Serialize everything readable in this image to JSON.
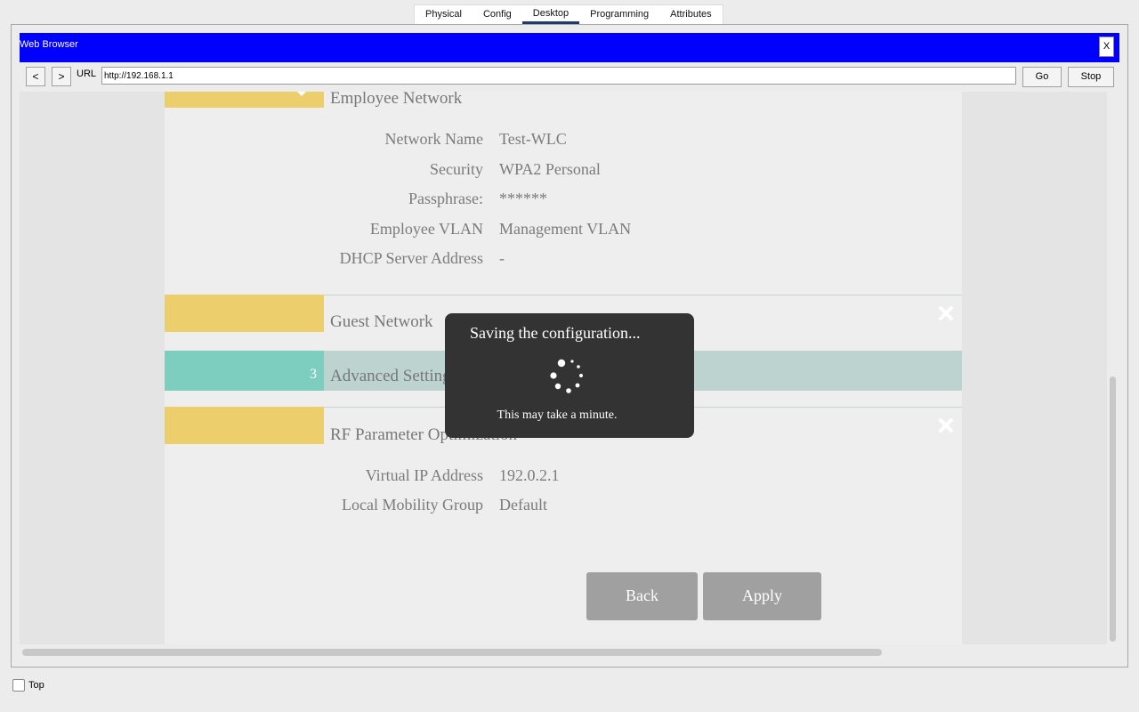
{
  "tabs": [
    {
      "label": "Physical",
      "active": false
    },
    {
      "label": "Config",
      "active": false
    },
    {
      "label": "Desktop",
      "active": true
    },
    {
      "label": "Programming",
      "active": false
    },
    {
      "label": "Attributes",
      "active": false
    }
  ],
  "browser": {
    "title": "Web Browser",
    "close_label": "X",
    "back_label": "<",
    "forward_label": ">",
    "url_label": "URL",
    "url_value": "http://192.168.1.1",
    "go_label": "Go",
    "stop_label": "Stop"
  },
  "page": {
    "employee_network": {
      "title": "Employee Network",
      "fields": [
        {
          "key": "Network Name",
          "value": "Test-WLC"
        },
        {
          "key": "Security",
          "value": "WPA2 Personal"
        },
        {
          "key": "Passphrase:",
          "value": "******"
        },
        {
          "key": "Employee VLAN",
          "value": "Management VLAN"
        },
        {
          "key": "DHCP Server Address",
          "value": "-"
        }
      ]
    },
    "guest_network": {
      "title": "Guest Network"
    },
    "advanced_settings": {
      "step": "3",
      "title": "Advanced Settings"
    },
    "rf_parameter": {
      "title": "RF Parameter Optimization",
      "fields": [
        {
          "key": "Virtual IP Address",
          "value": "192.0.2.1"
        },
        {
          "key": "Local Mobility Group",
          "value": "Default"
        }
      ]
    },
    "back_label": "Back",
    "apply_label": "Apply"
  },
  "modal": {
    "title": "Saving the configuration...",
    "subtitle": "This may take a minute."
  },
  "bottom": {
    "top_label": "Top",
    "top_checked": false
  },
  "colors": {
    "titlebar": "#0000ff",
    "section_yellow": "#ecce6c",
    "section_teal": "#7dcebf",
    "teal_bar": "#bcd3d0",
    "modal_bg": "#333333"
  }
}
